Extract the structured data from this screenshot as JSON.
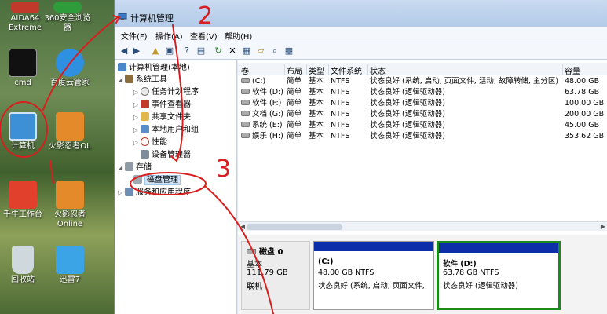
{
  "desktop": {
    "icons": [
      {
        "label": "AIDA64\nExtreme"
      },
      {
        "label": "360安全浏览\n器"
      },
      {
        "label": "cmd"
      },
      {
        "label": "百度云管家"
      },
      {
        "label": "计算机"
      },
      {
        "label": "火影忍者OL"
      },
      {
        "label": "千牛工作台"
      },
      {
        "label": "火影忍者\nOnline"
      },
      {
        "label": "回收站"
      },
      {
        "label": "迅雷7"
      }
    ]
  },
  "window": {
    "title": "计算机管理",
    "menu": [
      "文件(F)",
      "操作(A)",
      "查看(V)",
      "帮助(H)"
    ],
    "toolbar_icons": [
      "back-icon",
      "forward-icon",
      "up-icon",
      "show-hide-tree-icon",
      "help-icon",
      "view-icon",
      "refresh-icon",
      "delete-icon",
      "properties-icon",
      "open-icon",
      "find-icon",
      "settings-icon"
    ]
  },
  "tree": {
    "root": "计算机管理(本地)",
    "system_tools": "系统工具",
    "items": [
      "任务计划程序",
      "事件查看器",
      "共享文件夹",
      "本地用户和组",
      "性能",
      "设备管理器"
    ],
    "storage": "存储",
    "disk_mgmt": "磁盘管理",
    "services": "服务和应用程序"
  },
  "volumes": {
    "headers": [
      "卷",
      "布局",
      "类型",
      "文件系统",
      "状态",
      "容量"
    ],
    "rows": [
      {
        "vol": "(C:)",
        "layout": "简单",
        "type": "基本",
        "fs": "NTFS",
        "status": "状态良好 (系统, 启动, 页面文件, 活动, 故障转储, 主分区)",
        "cap": "48.00 GB"
      },
      {
        "vol": "软件 (D:)",
        "layout": "简单",
        "type": "基本",
        "fs": "NTFS",
        "status": "状态良好 (逻辑驱动器)",
        "cap": "63.78 GB"
      },
      {
        "vol": "软件 (F:)",
        "layout": "简单",
        "type": "基本",
        "fs": "NTFS",
        "status": "状态良好 (逻辑驱动器)",
        "cap": "100.00 GB"
      },
      {
        "vol": "文档 (G:)",
        "layout": "简单",
        "type": "基本",
        "fs": "NTFS",
        "status": "状态良好 (逻辑驱动器)",
        "cap": "200.00 GB"
      },
      {
        "vol": "系统 (E:)",
        "layout": "简单",
        "type": "基本",
        "fs": "NTFS",
        "status": "状态良好 (逻辑驱动器)",
        "cap": "45.00 GB"
      },
      {
        "vol": "娱乐 (H:)",
        "layout": "简单",
        "type": "基本",
        "fs": "NTFS",
        "status": "状态良好 (逻辑驱动器)",
        "cap": "353.62 GB"
      }
    ]
  },
  "disk0": {
    "name": "磁盘 0",
    "type": "基本",
    "size": "111.79 GB",
    "status": "联机",
    "partitions": [
      {
        "name": "(C:)",
        "size": "48.00 GB NTFS",
        "status": "状态良好 (系统, 启动, 页面文件,"
      },
      {
        "name": "软件  (D:)",
        "size": "63.78 GB NTFS",
        "status": "状态良好 (逻辑驱动器)"
      }
    ]
  },
  "annotations": [
    "2",
    "3"
  ],
  "colors": {
    "partition_bar": "#0d2ea9",
    "selected_border": "#1b8a1b",
    "annotation": "#d81e1e"
  }
}
